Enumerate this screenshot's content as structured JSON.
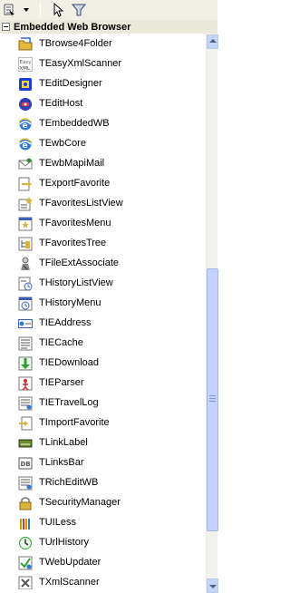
{
  "category": {
    "title": "Embedded Web Browser"
  },
  "toolbar": {
    "icons": [
      "categories-icon",
      "dropdown-arrow-icon",
      "pointer-icon",
      "filter-icon"
    ]
  },
  "items": [
    {
      "label": "TBrowse4Folder",
      "icon": "folder-icon",
      "color": "#e3b740"
    },
    {
      "label": "TEasyXmlScanner",
      "icon": "easyxml-icon",
      "color": "#5a5a5a"
    },
    {
      "label": "TEditDesigner",
      "icon": "designer-icon",
      "color": "#1f3ed8"
    },
    {
      "label": "TEditHost",
      "icon": "host-icon",
      "color": "#2e3fb8"
    },
    {
      "label": "TEmbeddedWB",
      "icon": "ie-globe-icon",
      "color": "#2d7bd6"
    },
    {
      "label": "TEwbCore",
      "icon": "ie-globe-icon",
      "color": "#2d7bd6"
    },
    {
      "label": "TEwbMapiMail",
      "icon": "mail-icon",
      "color": "#3a8d3a"
    },
    {
      "label": "TExportFavorite",
      "icon": "export-icon",
      "color": "#d9b43a"
    },
    {
      "label": "TFavoritesListView",
      "icon": "favorites-list-icon",
      "color": "#d9b43a"
    },
    {
      "label": "TFavoritesMenu",
      "icon": "favorites-menu-icon",
      "color": "#d9b43a"
    },
    {
      "label": "TFavoritesTree",
      "icon": "favorites-tree-icon",
      "color": "#d9b43a"
    },
    {
      "label": "TFileExtAssociate",
      "icon": "associate-icon",
      "color": "#8a8a8a"
    },
    {
      "label": "THistoryListView",
      "icon": "history-list-icon",
      "color": "#3a5fbf"
    },
    {
      "label": "THistoryMenu",
      "icon": "history-menu-icon",
      "color": "#3a5fbf"
    },
    {
      "label": "TIEAddress",
      "icon": "address-icon",
      "color": "#3a5fbf"
    },
    {
      "label": "TIECache",
      "icon": "cache-icon",
      "color": "#555555"
    },
    {
      "label": "TIEDownload",
      "icon": "download-icon",
      "color": "#2f9e2f"
    },
    {
      "label": "TIEParser",
      "icon": "parser-icon",
      "color": "#c83030"
    },
    {
      "label": "TIETravelLog",
      "icon": "travellog-icon",
      "color": "#555555"
    },
    {
      "label": "TImportFavorite",
      "icon": "import-icon",
      "color": "#d9b43a"
    },
    {
      "label": "TLinkLabel",
      "icon": "link-label-icon",
      "color": "#6b8e23"
    },
    {
      "label": "TLinksBar",
      "icon": "links-bar-icon",
      "color": "#555555"
    },
    {
      "label": "TRichEditWB",
      "icon": "richedit-icon",
      "color": "#555555"
    },
    {
      "label": "TSecurityManager",
      "icon": "lock-icon",
      "color": "#d9b43a"
    },
    {
      "label": "TUILess",
      "icon": "uiless-icon",
      "color": "#c8a000"
    },
    {
      "label": "TUrlHistory",
      "icon": "urlhistory-icon",
      "color": "#2f9e2f"
    },
    {
      "label": "TWebUpdater",
      "icon": "updater-icon",
      "color": "#2f9e2f"
    },
    {
      "label": "TXmlScanner",
      "icon": "xmlscanner-icon",
      "color": "#555555"
    }
  ]
}
